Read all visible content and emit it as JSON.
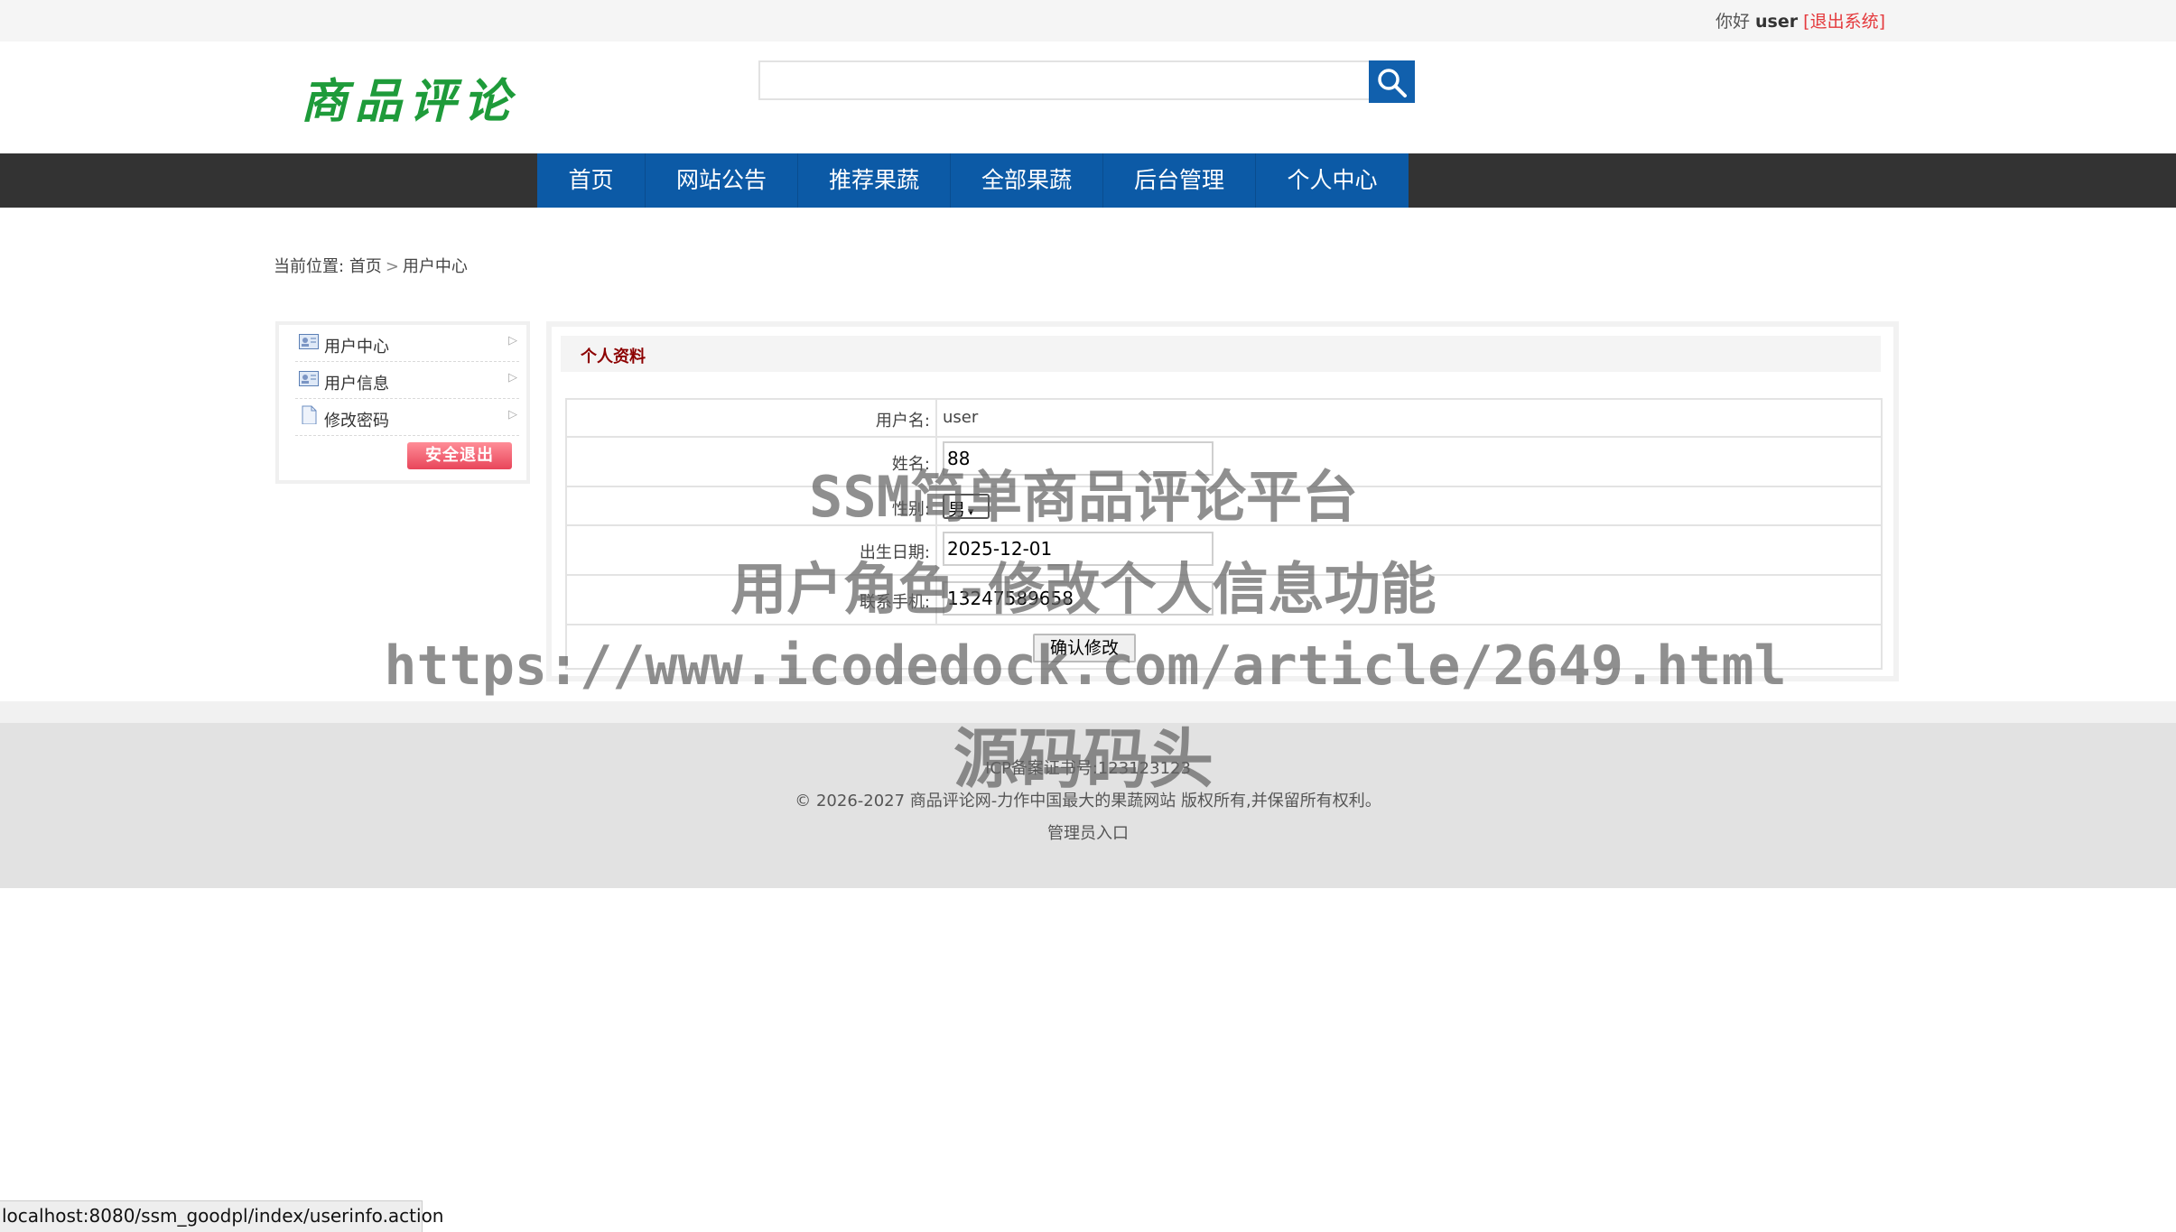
{
  "topbar": {
    "greeting": "你好",
    "username": "user",
    "logout_link": "[退出系统]"
  },
  "header": {
    "logo_text": "商品评论",
    "search": {
      "value": "",
      "placeholder": ""
    }
  },
  "nav": {
    "items": [
      "首页",
      "网站公告",
      "推荐果蔬",
      "全部果蔬",
      "后台管理",
      "个人中心"
    ],
    "active_color": "#0c5aa6"
  },
  "breadcrumb": {
    "prefix": "当前位置:",
    "home": "首页",
    "separator": ">",
    "current": "用户中心"
  },
  "sidebar": {
    "items": [
      "用户中心",
      "用户信息",
      "修改密码"
    ],
    "logout_button": "安全退出"
  },
  "panel": {
    "title": "个人资料",
    "fields": {
      "username_label": "用户名:",
      "username_value": "user",
      "name_label": "姓名:",
      "name_value": "88",
      "gender_label": "性别:",
      "gender_value": "男",
      "birth_label": "出生日期:",
      "birth_value": "2025-12-01",
      "phone_label": "联系手机:",
      "phone_value": "13247589658"
    },
    "submit_label": "确认修改"
  },
  "footer": {
    "icp": "ICP备案证书号:123123123",
    "copyright": "© 2026-2027 商品评论网-力作中国最大的果蔬网站 版权所有,并保留所有权利。",
    "admin_link": "管理员入口"
  },
  "watermark": {
    "line1": "SSM简单商品评论平台",
    "line2": "用户角色-修改个人信息功能",
    "line3": "https://www.icodedock.com/article/2649.html",
    "line4": "源码码头"
  },
  "statusbar": {
    "url": "localhost:8080/ssm_goodpl/index/userinfo.action"
  }
}
